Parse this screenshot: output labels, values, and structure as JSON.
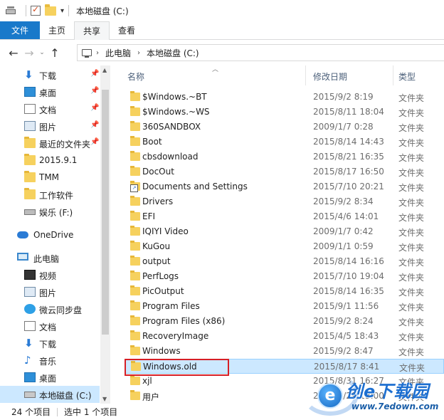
{
  "window": {
    "title": "本地磁盘 (C:)"
  },
  "ribbon": {
    "tabs": [
      "文件",
      "主页",
      "共享",
      "查看"
    ]
  },
  "address": {
    "crumbs": [
      "此电脑",
      "本地磁盘 (C:)"
    ]
  },
  "nav": {
    "items": [
      {
        "label": "下载",
        "icon": "download-icon",
        "pinned": true
      },
      {
        "label": "桌面",
        "icon": "desktop-icon",
        "pinned": true
      },
      {
        "label": "文档",
        "icon": "document-icon",
        "pinned": true
      },
      {
        "label": "图片",
        "icon": "pictures-icon",
        "pinned": true
      },
      {
        "label": "最近的文件夹",
        "icon": "recent-folder-icon",
        "pinned": true
      },
      {
        "label": "2015.9.1",
        "icon": "folder-icon",
        "pinned": false
      },
      {
        "label": "TMM",
        "icon": "folder-icon",
        "pinned": false
      },
      {
        "label": "工作软件",
        "icon": "folder-icon",
        "pinned": false
      },
      {
        "label": "娱乐 (F:)",
        "icon": "drive-icon",
        "pinned": false
      },
      {
        "label": "OneDrive",
        "icon": "onedrive-icon",
        "pinned": false
      },
      {
        "label": "此电脑",
        "icon": "computer-icon",
        "pinned": false
      },
      {
        "label": "视频",
        "icon": "video-icon",
        "pinned": false
      },
      {
        "label": "图片",
        "icon": "pictures-icon",
        "pinned": false
      },
      {
        "label": "微云同步盘",
        "icon": "weiyun-icon",
        "pinned": false
      },
      {
        "label": "文档",
        "icon": "document-icon",
        "pinned": false
      },
      {
        "label": "下载",
        "icon": "download-icon",
        "pinned": false
      },
      {
        "label": "音乐",
        "icon": "music-icon",
        "pinned": false
      },
      {
        "label": "桌面",
        "icon": "desktop-icon",
        "pinned": false
      },
      {
        "label": "本地磁盘 (C:)",
        "icon": "system-drive-icon",
        "pinned": false
      }
    ]
  },
  "columns": {
    "name": "名称",
    "modified": "修改日期",
    "type": "类型"
  },
  "files": [
    {
      "name": "$Windows.~BT",
      "date": "2015/9/2 8:19",
      "type": "文件夹"
    },
    {
      "name": "$Windows.~WS",
      "date": "2015/8/11 18:04",
      "type": "文件夹"
    },
    {
      "name": "360SANDBOX",
      "date": "2009/1/7 0:28",
      "type": "文件夹"
    },
    {
      "name": "Boot",
      "date": "2015/8/14 14:43",
      "type": "文件夹"
    },
    {
      "name": "cbsdownload",
      "date": "2015/8/21 16:35",
      "type": "文件夹"
    },
    {
      "name": "DocOut",
      "date": "2015/8/17 16:50",
      "type": "文件夹"
    },
    {
      "name": "Documents and Settings",
      "date": "2015/7/10 20:21",
      "type": "文件夹"
    },
    {
      "name": "Drivers",
      "date": "2015/9/2 8:34",
      "type": "文件夹"
    },
    {
      "name": "EFI",
      "date": "2015/4/6 14:01",
      "type": "文件夹"
    },
    {
      "name": "IQIYI Video",
      "date": "2009/1/7 0:42",
      "type": "文件夹"
    },
    {
      "name": "KuGou",
      "date": "2009/1/1 0:59",
      "type": "文件夹"
    },
    {
      "name": "output",
      "date": "2015/8/14 16:16",
      "type": "文件夹"
    },
    {
      "name": "PerfLogs",
      "date": "2015/7/10 19:04",
      "type": "文件夹"
    },
    {
      "name": "PicOutput",
      "date": "2015/8/14 16:35",
      "type": "文件夹"
    },
    {
      "name": "Program Files",
      "date": "2015/9/1 11:56",
      "type": "文件夹"
    },
    {
      "name": "Program Files (x86)",
      "date": "2015/9/2 8:24",
      "type": "文件夹"
    },
    {
      "name": "RecoveryImage",
      "date": "2015/4/5 18:43",
      "type": "文件夹"
    },
    {
      "name": "Windows",
      "date": "2015/9/2 8:47",
      "type": "文件夹"
    },
    {
      "name": "Windows.old",
      "date": "2015/8/17 8:41",
      "type": "文件夹"
    },
    {
      "name": "xjl",
      "date": "2015/8/31 16:27",
      "type": "文件夹"
    },
    {
      "name": "用户",
      "date": "2015/8/29 13:00",
      "type": "文件夹"
    }
  ],
  "status": {
    "item_count": "24 个项目",
    "selected": "选中 1 个项目"
  },
  "watermark": {
    "brand": "创e下载园",
    "url": "www.7edown.com"
  },
  "colors": {
    "accent": "#1979ca",
    "selection": "#cce8ff",
    "highlight_box": "#d61f26"
  }
}
